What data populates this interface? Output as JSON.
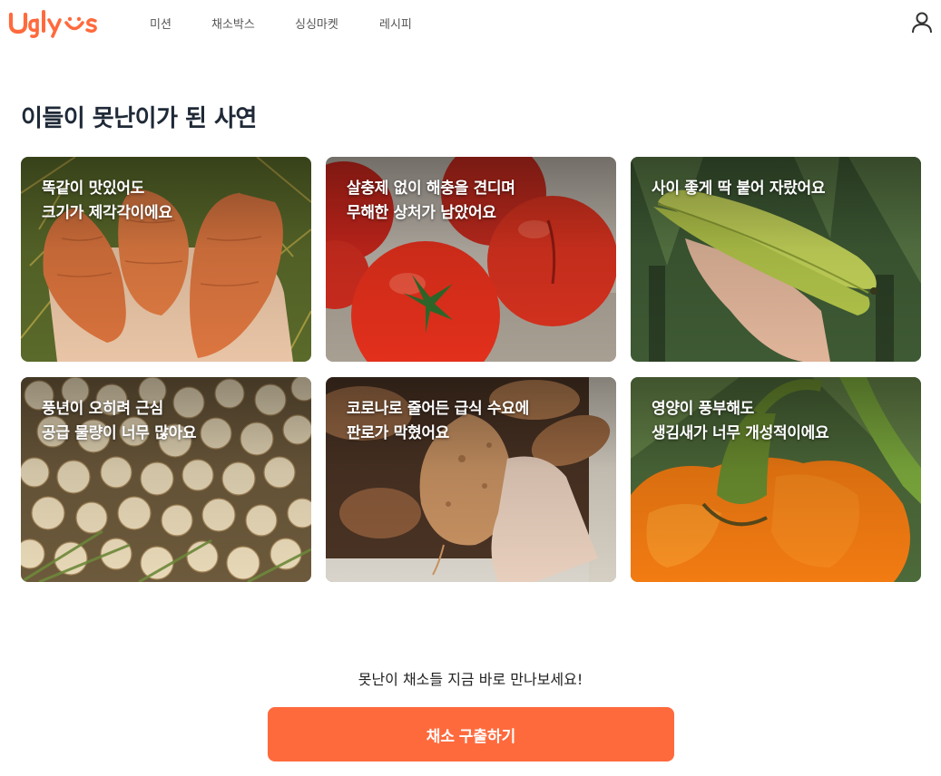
{
  "brand": {
    "name": "Ugly Us",
    "accent": "#ff6a3d"
  },
  "nav": {
    "items": [
      {
        "label": "미션"
      },
      {
        "label": "채소박스"
      },
      {
        "label": "싱싱마켓"
      },
      {
        "label": "레시피"
      }
    ],
    "user_icon": "user-icon"
  },
  "main": {
    "title": "이들이 못난이가 된 사연",
    "cards": [
      {
        "line1": "똑같이 맛있어도",
        "line2": "크기가 제각각이에요",
        "image": "carrots"
      },
      {
        "line1": "살충제 없이 해충을 견디며",
        "line2": "무해한 상처가 남았어요",
        "image": "tomatoes"
      },
      {
        "line1": "사이 좋게 딱 붙어 자랐어요",
        "line2": "",
        "image": "bananas"
      },
      {
        "line1": "풍년이 오히려 근심",
        "line2": "공급 물량이 너무 많아요",
        "image": "onions"
      },
      {
        "line1": "코로나로 줄어든 급식 수요에",
        "line2": "판로가 막혔어요",
        "image": "sweet-potatoes"
      },
      {
        "line1": "영양이 풍부해도",
        "line2": "생김새가 너무 개성적이에요",
        "image": "bell-pepper"
      }
    ]
  },
  "cta": {
    "text": "못난이 채소들 지금 바로 만나보세요!",
    "button_label": "채소 구출하기"
  }
}
